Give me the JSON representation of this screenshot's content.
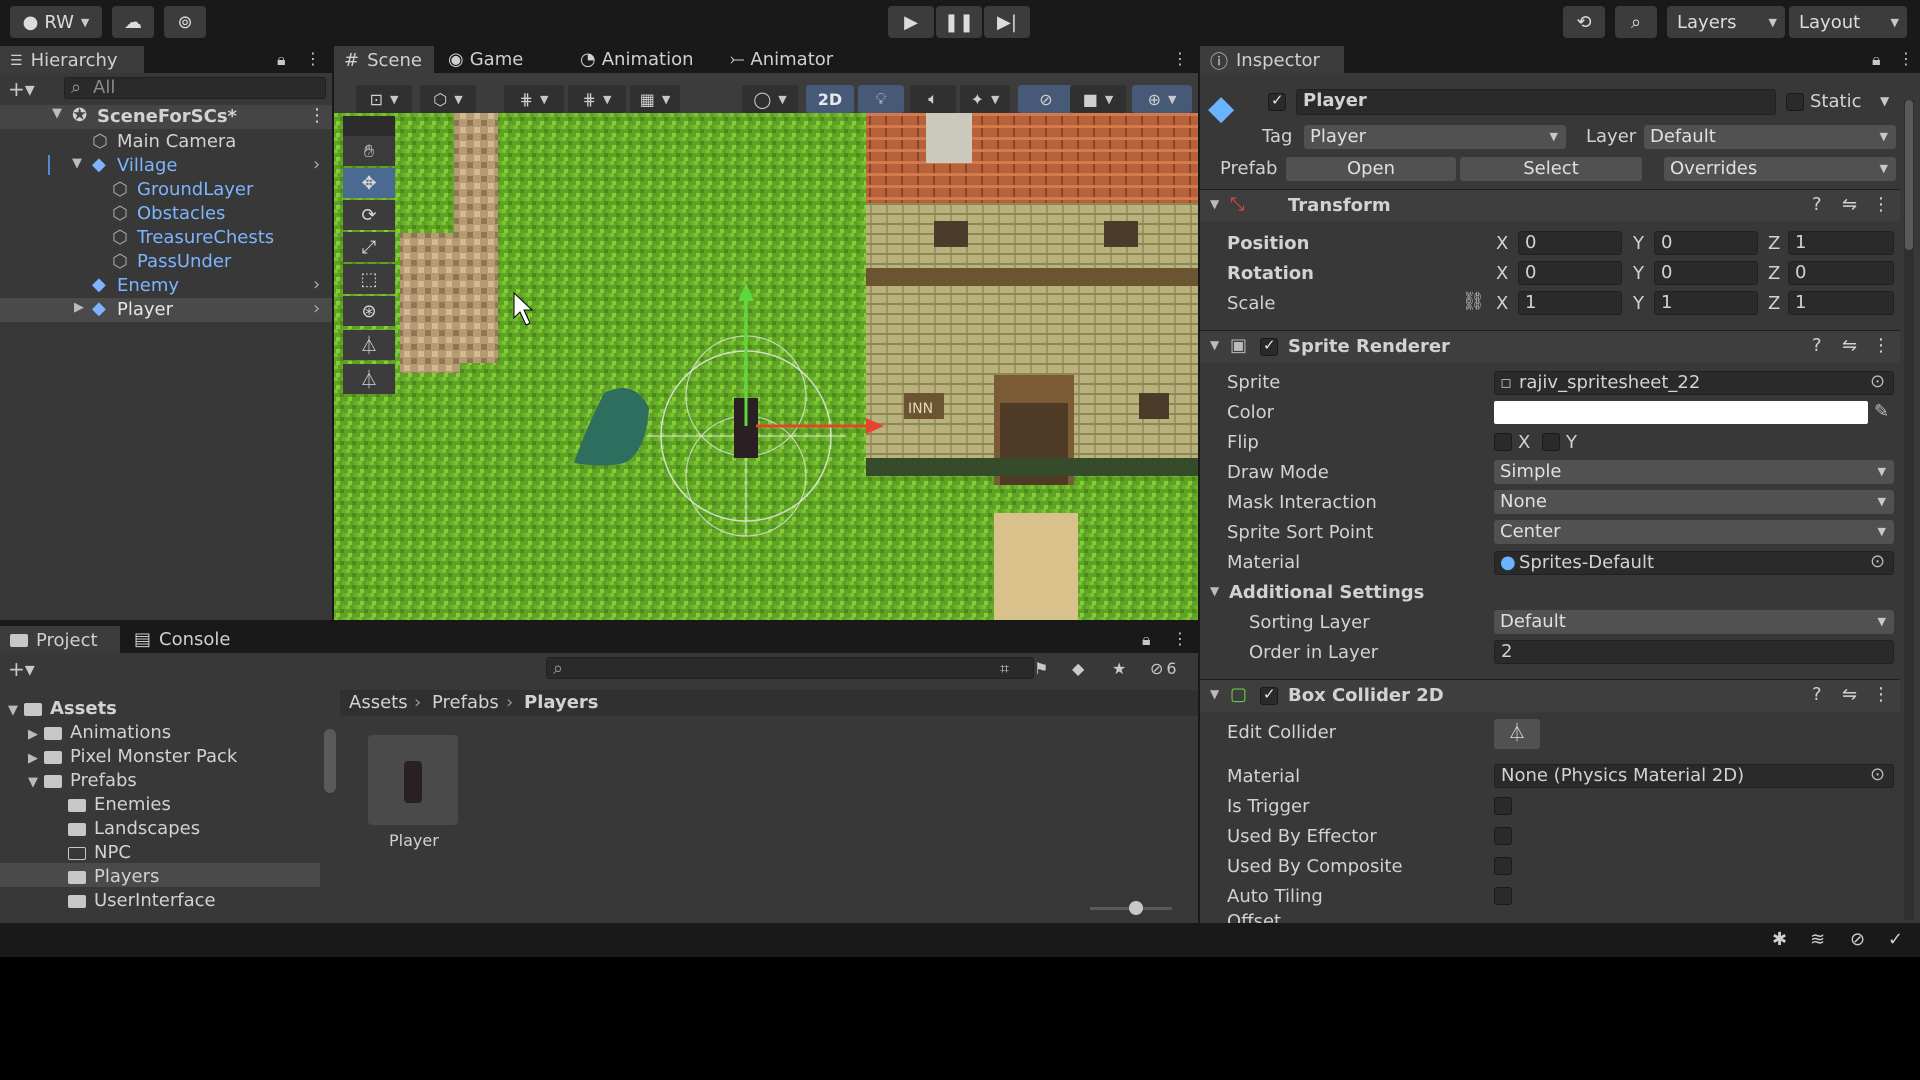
{
  "toolbar": {
    "account": "RW",
    "layers": "Layers",
    "layout": "Layout"
  },
  "hierarchy": {
    "tab": "Hierarchy",
    "search_placeholder": "All",
    "scene": "SceneForSCs*",
    "items": [
      {
        "label": "Main Camera"
      },
      {
        "label": "Village"
      },
      {
        "label": "GroundLayer"
      },
      {
        "label": "Obstacles"
      },
      {
        "label": "TreasureChests"
      },
      {
        "label": "PassUnder"
      },
      {
        "label": "Enemy"
      },
      {
        "label": "Player"
      }
    ]
  },
  "scene_tabs": [
    {
      "label": "Scene"
    },
    {
      "label": "Game"
    },
    {
      "label": "Animation"
    },
    {
      "label": "Animator"
    }
  ],
  "scene_toolbar": {
    "mode_2d": "2D"
  },
  "scene_view": {
    "inn_sign": "INN"
  },
  "project": {
    "tabs": [
      {
        "label": "Project"
      },
      {
        "label": "Console"
      }
    ],
    "hidden_count": "6",
    "breadcrumb": [
      "Assets",
      "Prefabs",
      "Players"
    ],
    "tree": [
      {
        "label": "Assets"
      },
      {
        "label": "Animations"
      },
      {
        "label": "Pixel Monster Pack"
      },
      {
        "label": "Prefabs"
      },
      {
        "label": "Enemies"
      },
      {
        "label": "Landscapes"
      },
      {
        "label": "NPC"
      },
      {
        "label": "Players"
      },
      {
        "label": "UserInterface"
      }
    ],
    "asset": "Player"
  },
  "inspector": {
    "tab": "Inspector",
    "name": "Player",
    "static_label": "Static",
    "tag_label": "Tag",
    "tag_value": "Player",
    "layer_label": "Layer",
    "layer_value": "Default",
    "prefab_label": "Prefab",
    "open": "Open",
    "select": "Select",
    "overrides": "Overrides",
    "transform": {
      "title": "Transform",
      "position_label": "Position",
      "position": [
        "0",
        "0",
        "1"
      ],
      "rotation_label": "Rotation",
      "rotation": [
        "0",
        "0",
        "0"
      ],
      "scale_label": "Scale",
      "scale": [
        "1",
        "1",
        "1"
      ]
    },
    "sprite_renderer": {
      "title": "Sprite Renderer",
      "sprite_label": "Sprite",
      "sprite": "rajiv_spritesheet_22",
      "color_label": "Color",
      "color": "#ffffff",
      "flip_label": "Flip",
      "draw_mode_label": "Draw Mode",
      "draw_mode": "Simple",
      "mask_label": "Mask Interaction",
      "mask": "None",
      "sort_point_label": "Sprite Sort Point",
      "sort_point": "Center",
      "material_label": "Material",
      "material": "Sprites-Default",
      "additional": "Additional Settings",
      "sorting_layer_label": "Sorting Layer",
      "sorting_layer": "Default",
      "order_label": "Order in Layer",
      "order": "2"
    },
    "box_collider": {
      "title": "Box Collider 2D",
      "edit_label": "Edit Collider",
      "material_label": "Material",
      "material": "None (Physics Material 2D)",
      "trigger_label": "Is Trigger",
      "effector_label": "Used By Effector",
      "composite_label": "Used By Composite",
      "tiling_label": "Auto Tiling",
      "offset_label": "Offset"
    }
  }
}
